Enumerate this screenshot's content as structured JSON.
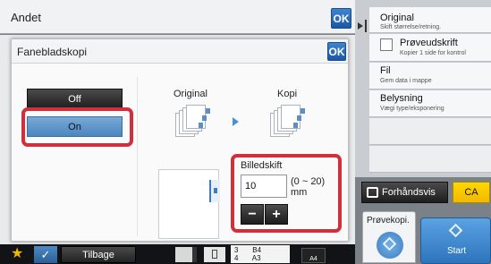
{
  "outer": {
    "title": "Andet",
    "ok_label": "OK"
  },
  "dialog": {
    "title": "Fanebladskopi",
    "ok_label": "OK",
    "off_label": "Off",
    "on_label": "On",
    "original_label": "Original",
    "copy_label": "Kopi",
    "image_shift": {
      "label": "Billedskift",
      "value": "10",
      "range": "(0 ~ 20)",
      "unit": "mm",
      "minus_label": "−",
      "plus_label": "+"
    }
  },
  "right_panel": {
    "items": [
      {
        "title": "Original",
        "subtitle": "Skift størrelse/retning."
      },
      {
        "title": "Prøveudskrift",
        "subtitle": "Kopier 1 side for kontrol"
      },
      {
        "title": "Fil",
        "subtitle": "Gem data i mappe"
      },
      {
        "title": "Belysning",
        "subtitle": "Vægi type/eksponering"
      }
    ],
    "preview_label": "Forhåndsvis",
    "ca_label": "CA",
    "proofcopy_label": "Prøvekopi.",
    "start_label": "Start"
  },
  "bottom_bar": {
    "back_label": "Tilbage",
    "trays": [
      {
        "number": "3",
        "size": "B4"
      },
      {
        "number": "4",
        "size": "A3"
      }
    ],
    "selected_paper": "A4",
    "icons": [
      "star-icon",
      "check-icon",
      "paper-icon",
      "tray-icon"
    ]
  },
  "colors": {
    "accent_blue": "#2f6fb8",
    "highlight_red": "#d0303c",
    "ca_yellow": "#f6c800"
  }
}
